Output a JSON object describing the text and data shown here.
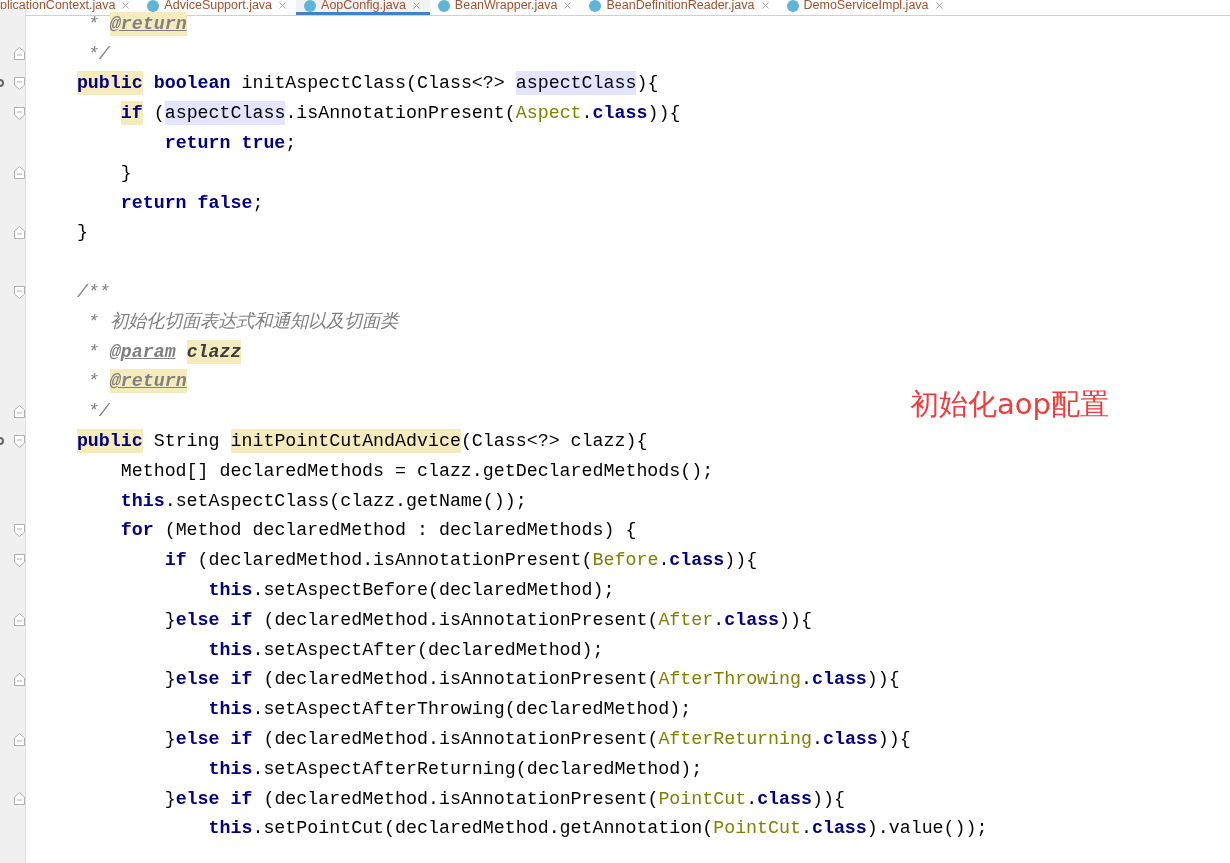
{
  "tabs": [
    {
      "label": "plicationContext.java",
      "selected": false,
      "icon": false
    },
    {
      "label": "AdviceSupport.java",
      "selected": false,
      "icon": true
    },
    {
      "label": "AopConfig.java",
      "selected": true,
      "icon": true
    },
    {
      "label": "BeanWrapper.java",
      "selected": false,
      "icon": true
    },
    {
      "label": "BeanDefinitionReader.java",
      "selected": false,
      "icon": true
    },
    {
      "label": "DemoServiceImpl.java",
      "selected": false,
      "icon": true
    }
  ],
  "lines": [
    {
      "tokens": [
        {
          "text": "     * ",
          "kind": "comment"
        },
        {
          "text": "@return",
          "kind": "doctag",
          "match_highlight": true
        }
      ]
    },
    {
      "fold_end": true,
      "tokens": [
        {
          "text": "     */",
          "kind": "comment"
        }
      ]
    },
    {
      "fold_start": true,
      "override": true,
      "tokens": [
        {
          "text": "    public",
          "kind": "keyword",
          "match_highlight": true
        },
        {
          "text": " boolean",
          "kind": "keyword"
        },
        {
          "text": " initAspectClass(Class<?> ",
          "kind": "plain"
        },
        {
          "text": "aspectClass",
          "kind": "plain",
          "usage_highlight": true
        },
        {
          "text": "){",
          "kind": "plain"
        }
      ]
    },
    {
      "fold_start": true,
      "tokens": [
        {
          "text": "        if",
          "kind": "keyword",
          "match_highlight": true
        },
        {
          "text": " (",
          "kind": "plain"
        },
        {
          "text": "aspectClass",
          "kind": "plain",
          "usage_highlight": true
        },
        {
          "text": ".isAnnotationPresent(",
          "kind": "plain"
        },
        {
          "text": "Aspect",
          "kind": "annotation"
        },
        {
          "text": ".",
          "kind": "plain"
        },
        {
          "text": "class",
          "kind": "keyword"
        },
        {
          "text": ")){",
          "kind": "plain"
        }
      ]
    },
    {
      "tokens": [
        {
          "text": "            return true",
          "kind": "keyword"
        },
        {
          "text": ";",
          "kind": "plain"
        }
      ]
    },
    {
      "fold_end": true,
      "tokens": [
        {
          "text": "        }",
          "kind": "plain"
        }
      ]
    },
    {
      "tokens": [
        {
          "text": "        return false",
          "kind": "keyword"
        },
        {
          "text": ";",
          "kind": "plain"
        }
      ]
    },
    {
      "fold_end": true,
      "blank_line_after": true,
      "tokens": [
        {
          "text": "    }",
          "kind": "plain"
        }
      ]
    },
    {
      "fold_start": true,
      "tokens": [
        {
          "text": "    /**",
          "kind": "comment"
        }
      ]
    },
    {
      "tokens": [
        {
          "text": "     * 初始化切面表达式和通知以及切面类",
          "kind": "comment"
        }
      ]
    },
    {
      "tokens": [
        {
          "text": "     * ",
          "kind": "comment"
        },
        {
          "text": "@param",
          "kind": "doctag"
        },
        {
          "text": " clazz",
          "kind": "docparam",
          "match_highlight": true
        }
      ]
    },
    {
      "tokens": [
        {
          "text": "     * ",
          "kind": "comment"
        },
        {
          "text": "@return",
          "kind": "doctag",
          "match_highlight": true
        }
      ]
    },
    {
      "fold_end": true,
      "tokens": [
        {
          "text": "     */",
          "kind": "comment"
        }
      ]
    },
    {
      "fold_start": true,
      "override": true,
      "tokens": [
        {
          "text": "    public",
          "kind": "keyword",
          "match_highlight": true
        },
        {
          "text": " String ",
          "kind": "plain"
        },
        {
          "text": "initPointCutAndAdvice",
          "kind": "plain",
          "match_highlight": true
        },
        {
          "text": "(Class<?> clazz){",
          "kind": "plain"
        }
      ]
    },
    {
      "tokens": [
        {
          "text": "        Method[] declaredMethods = clazz.getDeclaredMethods();",
          "kind": "plain"
        }
      ]
    },
    {
      "tokens": [
        {
          "text": "        this",
          "kind": "keyword"
        },
        {
          "text": ".setAspectClass(clazz.getName());",
          "kind": "plain"
        }
      ]
    },
    {
      "fold_start": true,
      "tokens": [
        {
          "text": "        for",
          "kind": "keyword"
        },
        {
          "text": " (Method declaredMethod : declaredMethods) {",
          "kind": "plain"
        }
      ]
    },
    {
      "fold_start": true,
      "tokens": [
        {
          "text": "            if",
          "kind": "keyword"
        },
        {
          "text": " (declaredMethod.isAnnotationPresent(",
          "kind": "plain"
        },
        {
          "text": "Before",
          "kind": "annotation"
        },
        {
          "text": ".",
          "kind": "plain"
        },
        {
          "text": "class",
          "kind": "keyword"
        },
        {
          "text": ")){",
          "kind": "plain"
        }
      ]
    },
    {
      "tokens": [
        {
          "text": "                this",
          "kind": "keyword"
        },
        {
          "text": ".setAspectBefore(declaredMethod);",
          "kind": "plain"
        }
      ]
    },
    {
      "fold_end": true,
      "tokens": [
        {
          "text": "            }",
          "kind": "plain"
        },
        {
          "text": "else if",
          "kind": "keyword"
        },
        {
          "text": " (declaredMethod.isAnnotationPresent(",
          "kind": "plain"
        },
        {
          "text": "After",
          "kind": "annotation"
        },
        {
          "text": ".",
          "kind": "plain"
        },
        {
          "text": "class",
          "kind": "keyword"
        },
        {
          "text": ")){",
          "kind": "plain"
        }
      ]
    },
    {
      "tokens": [
        {
          "text": "                this",
          "kind": "keyword"
        },
        {
          "text": ".setAspectAfter(declaredMethod);",
          "kind": "plain"
        }
      ]
    },
    {
      "fold_end": true,
      "tokens": [
        {
          "text": "            }",
          "kind": "plain"
        },
        {
          "text": "else if",
          "kind": "keyword"
        },
        {
          "text": " (declaredMethod.isAnnotationPresent(",
          "kind": "plain"
        },
        {
          "text": "AfterThrowing",
          "kind": "annotation"
        },
        {
          "text": ".",
          "kind": "plain"
        },
        {
          "text": "class",
          "kind": "keyword"
        },
        {
          "text": ")){",
          "kind": "plain"
        }
      ]
    },
    {
      "tokens": [
        {
          "text": "                this",
          "kind": "keyword"
        },
        {
          "text": ".setAspectAfterThrowing(declaredMethod);",
          "kind": "plain"
        }
      ]
    },
    {
      "fold_end": true,
      "tokens": [
        {
          "text": "            }",
          "kind": "plain"
        },
        {
          "text": "else if",
          "kind": "keyword"
        },
        {
          "text": " (declaredMethod.isAnnotationPresent(",
          "kind": "plain"
        },
        {
          "text": "AfterReturning",
          "kind": "annotation"
        },
        {
          "text": ".",
          "kind": "plain"
        },
        {
          "text": "class",
          "kind": "keyword"
        },
        {
          "text": ")){",
          "kind": "plain"
        }
      ]
    },
    {
      "tokens": [
        {
          "text": "                this",
          "kind": "keyword"
        },
        {
          "text": ".setAspectAfterReturning(declaredMethod);",
          "kind": "plain"
        }
      ]
    },
    {
      "fold_end": true,
      "tokens": [
        {
          "text": "            }",
          "kind": "plain"
        },
        {
          "text": "else if",
          "kind": "keyword"
        },
        {
          "text": " (declaredMethod.isAnnotationPresent(",
          "kind": "plain"
        },
        {
          "text": "PointCut",
          "kind": "annotation"
        },
        {
          "text": ".",
          "kind": "plain"
        },
        {
          "text": "class",
          "kind": "keyword"
        },
        {
          "text": ")){",
          "kind": "plain"
        }
      ]
    },
    {
      "tokens": [
        {
          "text": "                this",
          "kind": "keyword"
        },
        {
          "text": ".setPointCut(declaredMethod.getAnnotation(",
          "kind": "plain"
        },
        {
          "text": "PointCut",
          "kind": "annotation"
        },
        {
          "text": ".",
          "kind": "plain"
        },
        {
          "text": "class",
          "kind": "keyword"
        },
        {
          "text": ").value());",
          "kind": "plain"
        }
      ]
    }
  ],
  "annotation_note": "初始化aop配置"
}
